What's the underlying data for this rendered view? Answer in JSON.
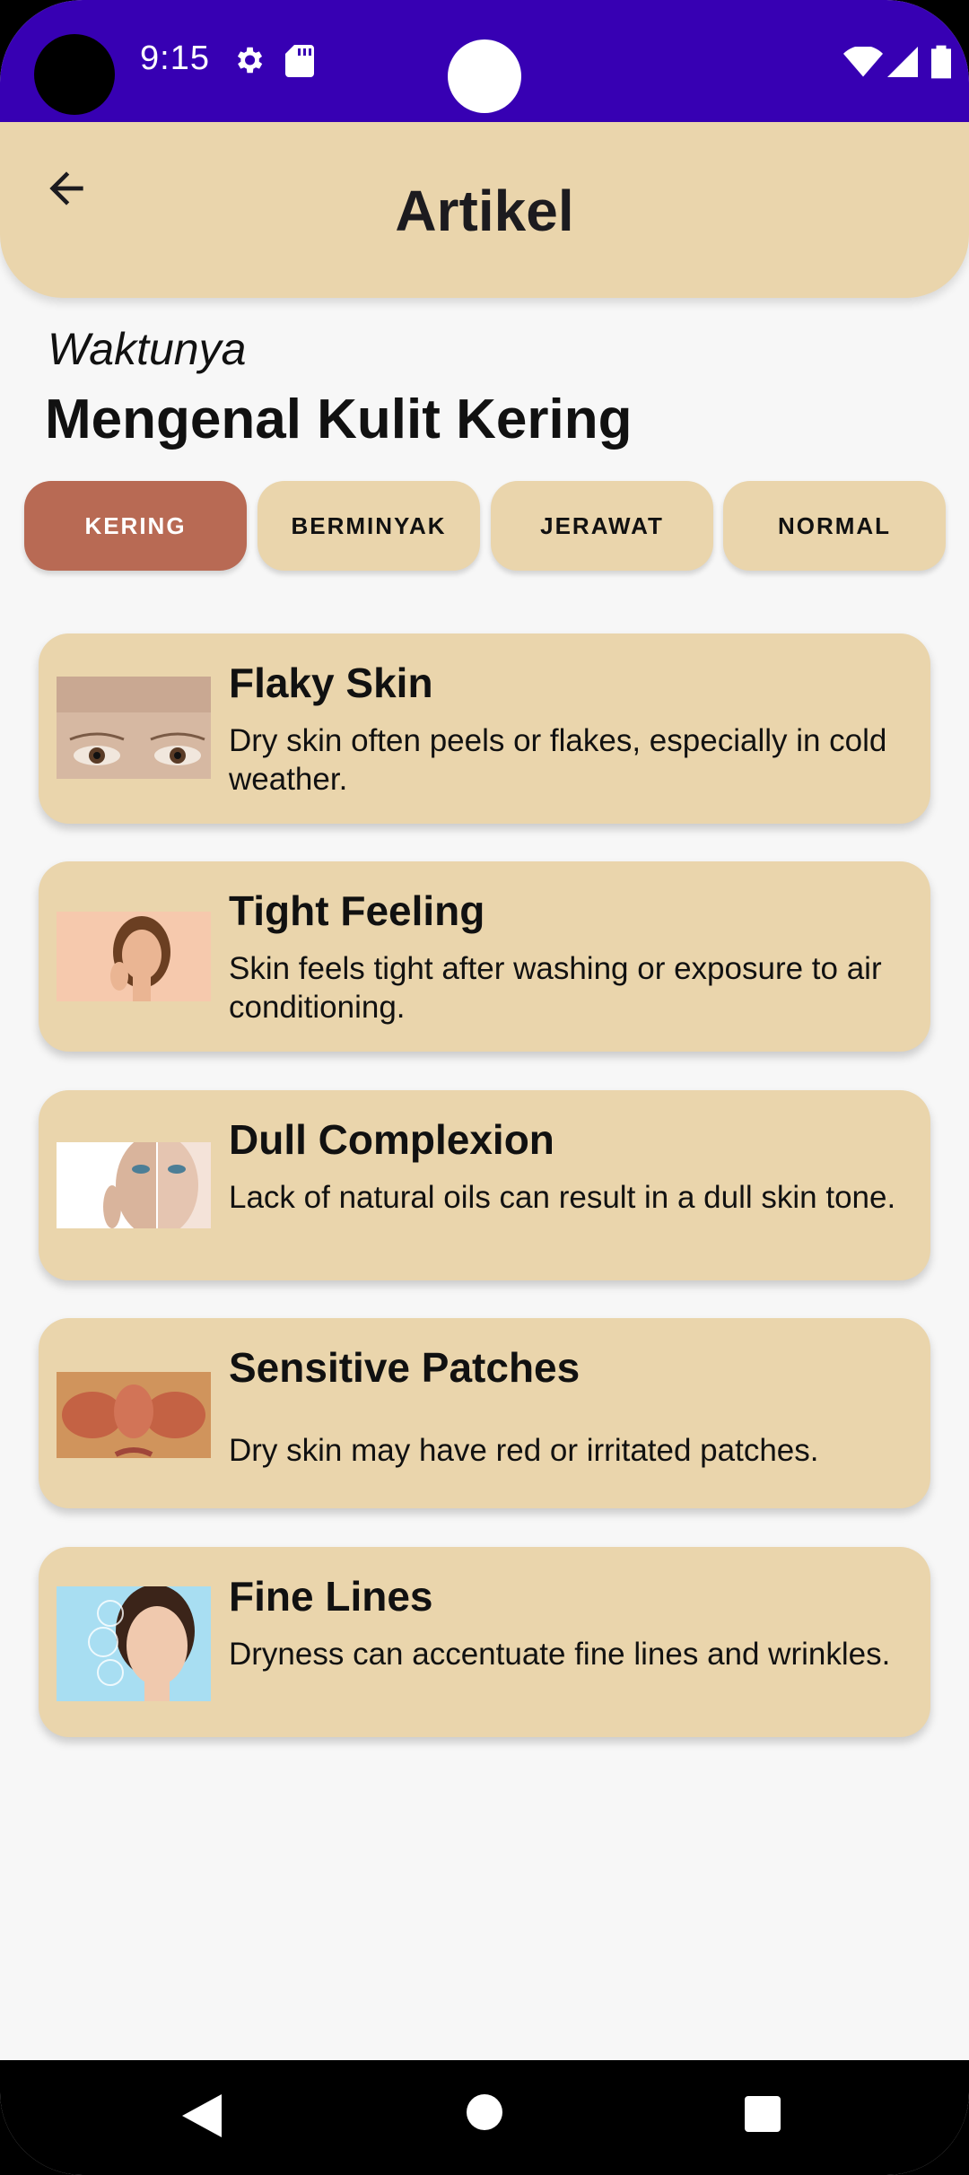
{
  "status_bar": {
    "time": "9:15",
    "icons": [
      "gear-icon",
      "sdcard-icon",
      "wifi-icon",
      "signal-icon",
      "battery-icon"
    ],
    "background": "#3700b3"
  },
  "appbar": {
    "title": "Artikel",
    "back_icon": "arrow-left-icon",
    "background": "#ead5ac"
  },
  "subtitle": "Waktunya",
  "headline": "Mengenal Kulit Kering",
  "tabs": [
    {
      "label": "KERING",
      "active": true
    },
    {
      "label": "BERMINYAK",
      "active": false
    },
    {
      "label": "JERAWAT",
      "active": false
    },
    {
      "label": "NORMAL",
      "active": false
    }
  ],
  "articles": [
    {
      "title": "Flaky Skin",
      "description": "Dry skin often peels or flakes, especially in cold weather."
    },
    {
      "title": "Tight Feeling",
      "description": "Skin feels tight after washing or exposure to air conditioning."
    },
    {
      "title": "Dull Complexion",
      "description": "Lack of natural oils can result in a dull skin tone."
    },
    {
      "title": "Sensitive Patches",
      "description": "Dry skin may have red or irritated patches."
    },
    {
      "title": "Fine Lines",
      "description": "Dryness can accentuate fine lines and wrinkles."
    }
  ],
  "navbar": {
    "icons": [
      "back-triangle-icon",
      "home-circle-icon",
      "recents-square-icon"
    ]
  },
  "colors": {
    "accent": "#b86a54",
    "card": "#ead5ac",
    "page": "#f7f7f7"
  }
}
